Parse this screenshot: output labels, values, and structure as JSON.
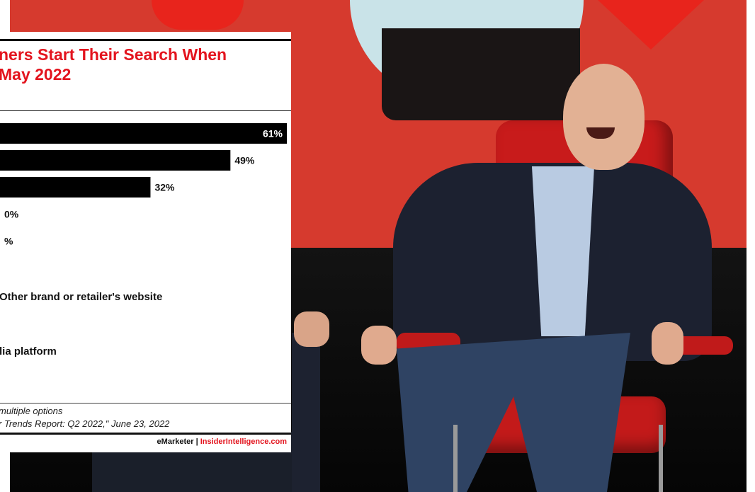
{
  "chart_data": {
    "type": "bar",
    "orientation": "horizontal",
    "title_lines": [
      "ners Start Their Search When",
      "May 2022"
    ],
    "values": [
      61,
      49,
      32,
      0,
      0
    ],
    "value_labels": [
      "61%",
      "49%",
      "32%",
      "0%",
      "%"
    ],
    "category_labels": [
      "Other brand or retailer's website",
      "lia platform"
    ],
    "notes": [
      "multiple options",
      "r Trends Report: Q2 2022,\" June 23, 2022"
    ],
    "credit": {
      "brand1": "eMarketer",
      "separator": "|",
      "brand2": "InsiderIntelligence.com"
    },
    "bar_color": "#000000",
    "accent_color": "#e3141e",
    "grid": false
  }
}
